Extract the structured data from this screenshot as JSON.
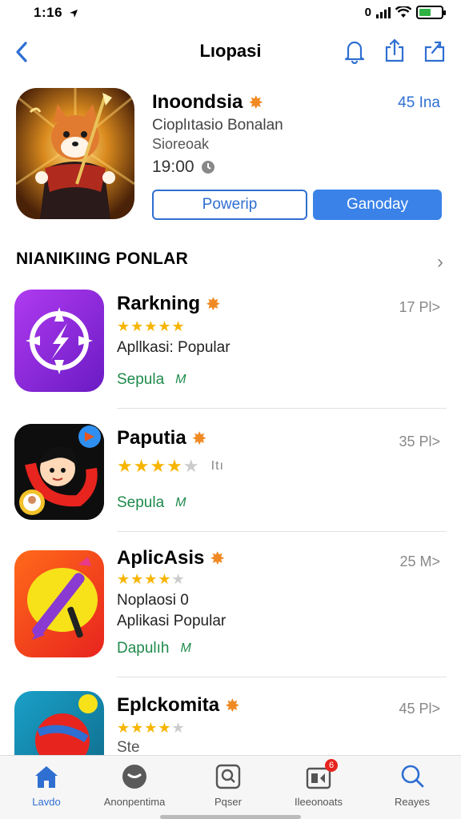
{
  "status": {
    "time": "1:16",
    "battery_text": "0"
  },
  "nav": {
    "title": "Lıopasi"
  },
  "hero": {
    "name": "Inoondsia",
    "size": "45 Ina",
    "subtitle": "Cioplıtasio Bonalan",
    "developer": "Sioreoak",
    "time": "19:00",
    "button_outline": "Powerip",
    "button_solid": "Ganoday"
  },
  "section": {
    "title": "NIANIKIING PONLAR"
  },
  "apps": [
    {
      "name": "Rarkning",
      "size": "17 Pl>",
      "desc": "Apllkasi: Popular",
      "tag": "Sepula",
      "tag_icon": "M"
    },
    {
      "name": "Paputia",
      "size": "35 Pl>",
      "rating_extra": "Itı",
      "tag": "Sepula",
      "tag_icon": "M"
    },
    {
      "name": "AplicAsis",
      "size": "25 M>",
      "desc": "Noplaosi 0",
      "desc2": "Aplikasi Popular",
      "tag": "Dapulıh",
      "tag_icon": "M"
    },
    {
      "name": "Eplckomita",
      "size": "45 Pl>",
      "desc": "Ste"
    }
  ],
  "tabs": [
    {
      "label": "Lavdo",
      "icon": "home-icon"
    },
    {
      "label": "Anonpentima",
      "icon": "games-icon"
    },
    {
      "label": "Pqser",
      "icon": "apps-icon"
    },
    {
      "label": "Ileeonoats",
      "icon": "updates-icon",
      "badge": "6"
    },
    {
      "label": "Reayes",
      "icon": "search-icon"
    }
  ],
  "colors": {
    "accent": "#2f6fd1",
    "button_solid": "#3a82e8",
    "star": "#f7b500",
    "tag": "#1f8a4c",
    "badge": "#f08a24"
  }
}
